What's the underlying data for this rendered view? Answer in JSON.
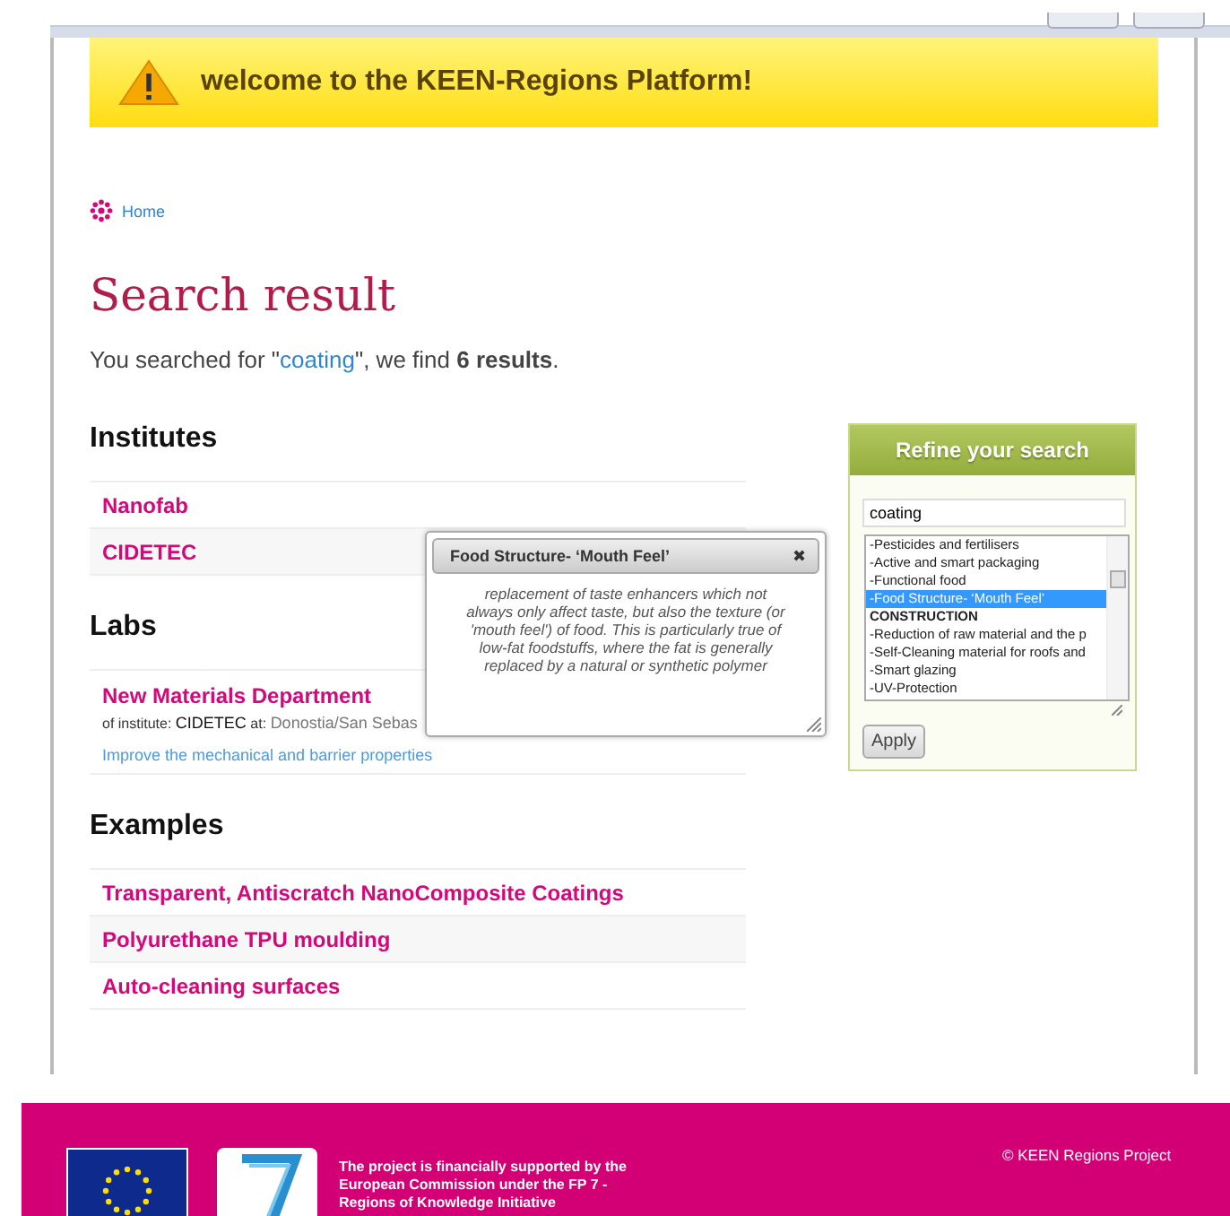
{
  "banner": {
    "text": "welcome to the KEEN-Regions Platform!"
  },
  "breadcrumb": {
    "label": "Home"
  },
  "title": "Search result",
  "summary": {
    "prefix": "You searched for \"",
    "query": "coating",
    "suffix": "\", we find **6 results**."
  },
  "institutes": {
    "heading": "Institutes",
    "items": [
      "Nanofab",
      "CIDETEC"
    ]
  },
  "labs": {
    "heading": "Labs",
    "items": [
      {
        "name": "New Materials Department",
        "institute_label": "of institute:",
        "institute": "CIDETEC",
        "at_label": "at:",
        "location": "Donostia/San Sebas",
        "description": "Improve the mechanical and barrier properties"
      }
    ]
  },
  "examples": {
    "heading": "Examples",
    "items": [
      "Transparent, Antiscratch NanoComposite Coatings",
      "Polyurethane TPU moulding",
      "Auto-cleaning surfaces"
    ]
  },
  "refine": {
    "title": "Refine your search",
    "query": "coating",
    "options": [
      {
        "kind": "option",
        "label": "-Pesticides and fertilisers",
        "selected": false
      },
      {
        "kind": "option",
        "label": "-Active and smart packaging",
        "selected": false
      },
      {
        "kind": "option",
        "label": "-Functional food",
        "selected": false
      },
      {
        "kind": "option",
        "label": "-Food Structure- ‘Mouth Feel’",
        "selected": true
      },
      {
        "kind": "group",
        "label": "CONSTRUCTION",
        "selected": false
      },
      {
        "kind": "option",
        "label": "-Reduction of raw material and the p",
        "selected": false
      },
      {
        "kind": "option",
        "label": "-Self-Cleaning material for roofs and",
        "selected": false
      },
      {
        "kind": "option",
        "label": "-Smart glazing",
        "selected": false
      },
      {
        "kind": "option",
        "label": "-UV-Protection",
        "selected": false
      }
    ],
    "button": "Apply"
  },
  "popup": {
    "title": "Food Structure- ‘Mouth Feel’",
    "close": "✖",
    "text": "replacement of taste enhancers which not always only affect taste, but also the texture (or 'mouth feel') of food. This is particularly true of low-fat foodstuffs, where the fat is generally replaced by a natural or synthetic polymer"
  },
  "footer": {
    "text": "The project is financially supported by the European Commission under the FP 7 - Regions of Knowledge Initiative",
    "copyright": "© KEEN Regions Project"
  }
}
